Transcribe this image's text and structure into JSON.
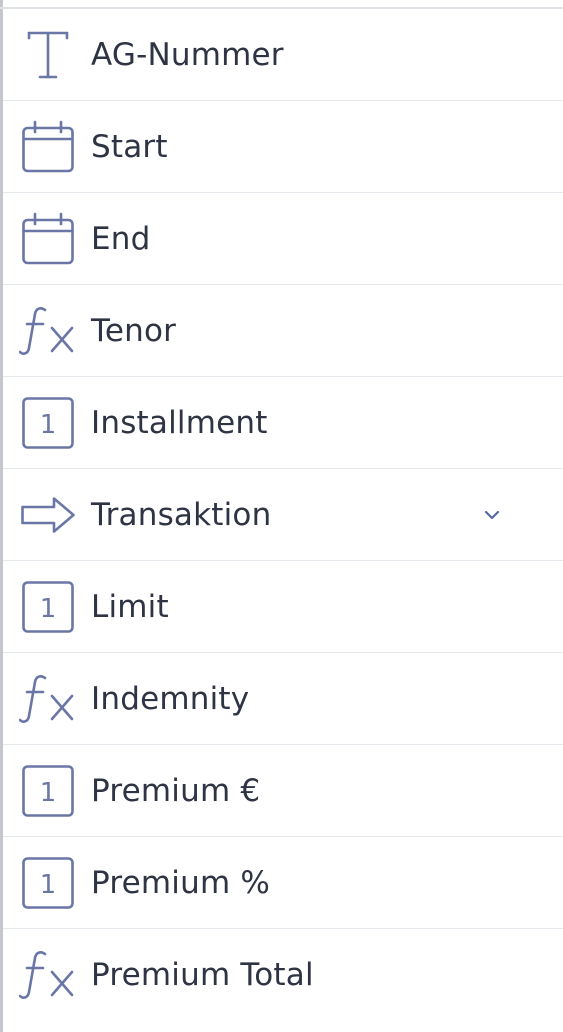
{
  "fields": [
    {
      "label": "AG-Nummer",
      "icon": "text-icon",
      "has_dropdown": false
    },
    {
      "label": "Start",
      "icon": "calendar-icon",
      "has_dropdown": false
    },
    {
      "label": "End",
      "icon": "calendar-icon",
      "has_dropdown": false
    },
    {
      "label": "Tenor",
      "icon": "formula-icon",
      "has_dropdown": false
    },
    {
      "label": "Installment",
      "icon": "number-icon",
      "has_dropdown": false
    },
    {
      "label": "Transaktion",
      "icon": "arrow-right-icon",
      "has_dropdown": true
    },
    {
      "label": "Limit",
      "icon": "number-icon",
      "has_dropdown": false
    },
    {
      "label": "Indemnity",
      "icon": "formula-icon",
      "has_dropdown": false
    },
    {
      "label": "Premium €",
      "icon": "number-icon",
      "has_dropdown": false
    },
    {
      "label": "Premium %",
      "icon": "number-icon",
      "has_dropdown": false
    },
    {
      "label": "Premium Total",
      "icon": "formula-icon",
      "has_dropdown": false
    }
  ],
  "number_icon_glyph": "1",
  "colors": {
    "icon": "#6a77a6",
    "label": "#2e3443",
    "divider": "#e6e9ee",
    "chevron": "#5b6aa0"
  }
}
